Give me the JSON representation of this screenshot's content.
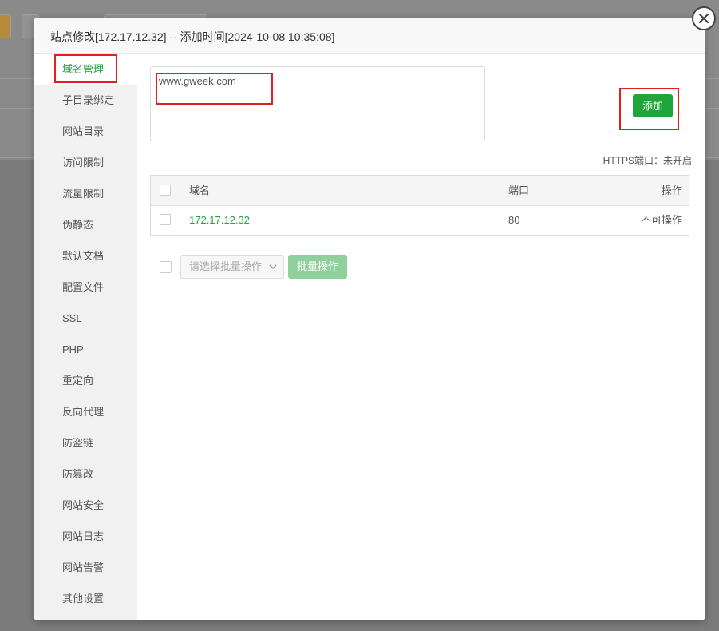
{
  "modal": {
    "title": "站点修改[172.17.12.32] -- 添加时间[2024-10-08 10:35:08]"
  },
  "sidebar": {
    "items": [
      {
        "label": "域名管理",
        "active": true
      },
      {
        "label": "子目录绑定"
      },
      {
        "label": "网站目录"
      },
      {
        "label": "访问限制"
      },
      {
        "label": "流量限制"
      },
      {
        "label": "伪静态"
      },
      {
        "label": "默认文档"
      },
      {
        "label": "配置文件"
      },
      {
        "label": "SSL"
      },
      {
        "label": "PHP"
      },
      {
        "label": "重定向"
      },
      {
        "label": "反向代理"
      },
      {
        "label": "防盗链"
      },
      {
        "label": "防篡改"
      },
      {
        "label": "网站安全"
      },
      {
        "label": "网站日志"
      },
      {
        "label": "网站告警"
      },
      {
        "label": "其他设置"
      }
    ]
  },
  "domain_input": {
    "value": "www.gweek.com"
  },
  "add_button": {
    "label": "添加"
  },
  "https_status": "HTTPS端口：未开启",
  "table": {
    "headers": {
      "domain": "域名",
      "port": "端口",
      "action": "操作"
    },
    "rows": [
      {
        "domain": "172.17.12.32",
        "port": "80",
        "action": "不可操作"
      }
    ]
  },
  "batch": {
    "select_placeholder": "请选择批量操作",
    "button": "批量操作"
  },
  "colors": {
    "accent": "#20a53a",
    "highlight_box": "#e02020"
  }
}
